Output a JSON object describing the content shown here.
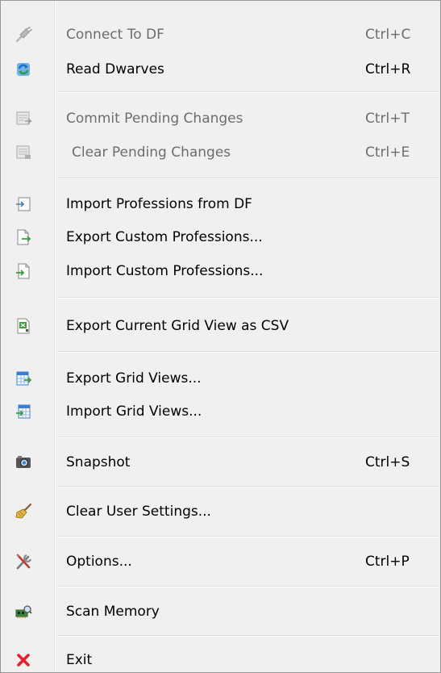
{
  "menu": {
    "items": [
      {
        "label": "Connect To DF",
        "shortcut": "Ctrl+C",
        "icon": "plug-icon",
        "enabled": false
      },
      {
        "label": "Read Dwarves",
        "shortcut": "Ctrl+R",
        "icon": "refresh-icon",
        "enabled": true
      },
      {
        "label": "Commit Pending Changes",
        "shortcut": "Ctrl+T",
        "icon": "commit-icon",
        "enabled": false
      },
      {
        "label": "Clear Pending Changes",
        "shortcut": "Ctrl+E",
        "icon": "clear-pending-icon",
        "enabled": false
      },
      {
        "label": "Import Professions from DF",
        "shortcut": "",
        "icon": "import-professions-icon",
        "enabled": true
      },
      {
        "label": "Export Custom Professions...",
        "shortcut": "",
        "icon": "export-document-icon",
        "enabled": true
      },
      {
        "label": "Import Custom Professions...",
        "shortcut": "",
        "icon": "import-document-icon",
        "enabled": true
      },
      {
        "label": "Export Current Grid View as CSV",
        "shortcut": "",
        "icon": "csv-icon",
        "enabled": true
      },
      {
        "label": "Export Grid Views...",
        "shortcut": "",
        "icon": "export-grid-icon",
        "enabled": true
      },
      {
        "label": "Import Grid Views...",
        "shortcut": "",
        "icon": "import-grid-icon",
        "enabled": true
      },
      {
        "label": "Snapshot",
        "shortcut": "Ctrl+S",
        "icon": "camera-icon",
        "enabled": true
      },
      {
        "label": "Clear User Settings...",
        "shortcut": "",
        "icon": "broom-icon",
        "enabled": true
      },
      {
        "label": "Options...",
        "shortcut": "Ctrl+P",
        "icon": "tools-icon",
        "enabled": true
      },
      {
        "label": "Scan Memory",
        "shortcut": "",
        "icon": "memory-scan-icon",
        "enabled": true
      },
      {
        "label": "Exit",
        "shortcut": "",
        "icon": "close-icon",
        "enabled": true
      }
    ]
  },
  "colors": {
    "background": "#f0f0f0",
    "disabled_text": "#6d6d6d",
    "exit_red": "#e8202a",
    "icon_blue": "#3a7fd0",
    "icon_green": "#3e9a3e"
  }
}
